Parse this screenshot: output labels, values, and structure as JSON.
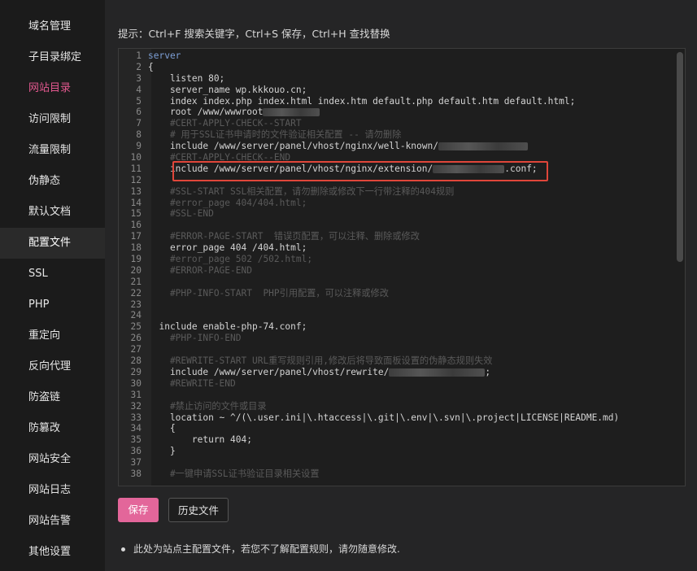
{
  "sidebar": {
    "items": [
      {
        "label": "域名管理"
      },
      {
        "label": "子目录绑定"
      },
      {
        "label": "网站目录"
      },
      {
        "label": "访问限制"
      },
      {
        "label": "流量限制"
      },
      {
        "label": "伪静态"
      },
      {
        "label": "默认文档"
      },
      {
        "label": "配置文件"
      },
      {
        "label": "SSL"
      },
      {
        "label": "PHP"
      },
      {
        "label": "重定向"
      },
      {
        "label": "反向代理"
      },
      {
        "label": "防盗链"
      },
      {
        "label": "防篡改"
      },
      {
        "label": "网站安全"
      },
      {
        "label": "网站日志"
      },
      {
        "label": "网站告警"
      },
      {
        "label": "其他设置"
      }
    ]
  },
  "hint": "提示：Ctrl+F 搜索关键字，Ctrl+S 保存，Ctrl+H 查找替换",
  "editor": {
    "lines": [
      {
        "n": "1",
        "text": "server",
        "style": "kw"
      },
      {
        "n": "2",
        "text": "{",
        "style": "tx"
      },
      {
        "n": "3",
        "text": "    listen 80;",
        "style": "tx"
      },
      {
        "n": "4",
        "text": "    server_name wp.kkkouo.cn;",
        "style": "tx"
      },
      {
        "n": "5",
        "text": "    index index.php index.html index.htm default.php default.htm default.html;",
        "style": "tx"
      },
      {
        "n": "6",
        "text": "    root /www/wwwroot",
        "style": "tx"
      },
      {
        "n": "7",
        "text": "    #CERT-APPLY-CHECK--START",
        "style": "cm"
      },
      {
        "n": "8",
        "text": "    # 用于SSL证书申请时的文件验证相关配置 -- 请勿删除",
        "style": "cm"
      },
      {
        "n": "9",
        "text": "    include /www/server/panel/vhost/nginx/well-known/",
        "style": "tx"
      },
      {
        "n": "10",
        "text": "    #CERT-APPLY-CHECK--END",
        "style": "cm"
      },
      {
        "n": "11",
        "text": "    include /www/server/panel/vhost/nginx/extension/",
        "suffix": ".conf;",
        "style": "tx"
      },
      {
        "n": "12",
        "text": "",
        "style": "tx"
      },
      {
        "n": "13",
        "text": "    #SSL-START SSL相关配置，请勿删除或修改下一行带注释的404规则",
        "style": "cm"
      },
      {
        "n": "14",
        "text": "    #error_page 404/404.html;",
        "style": "cm"
      },
      {
        "n": "15",
        "text": "    #SSL-END",
        "style": "cm"
      },
      {
        "n": "16",
        "text": "",
        "style": "tx"
      },
      {
        "n": "17",
        "text": "    #ERROR-PAGE-START  错误页配置，可以注释、删除或修改",
        "style": "cm"
      },
      {
        "n": "18",
        "text": "    error_page 404 /404.html;",
        "style": "tx"
      },
      {
        "n": "19",
        "text": "    #error_page 502 /502.html;",
        "style": "cm"
      },
      {
        "n": "20",
        "text": "    #ERROR-PAGE-END",
        "style": "cm"
      },
      {
        "n": "21",
        "text": "",
        "style": "tx"
      },
      {
        "n": "22",
        "text": "    #PHP-INFO-START  PHP引用配置，可以注释或修改",
        "style": "cm"
      },
      {
        "n": "23",
        "text": "",
        "style": "tx"
      },
      {
        "n": "24",
        "text": "",
        "style": "tx"
      },
      {
        "n": "25",
        "text": "  include enable-php-74.conf;",
        "style": "tx"
      },
      {
        "n": "26",
        "text": "    #PHP-INFO-END",
        "style": "cm"
      },
      {
        "n": "27",
        "text": "",
        "style": "tx"
      },
      {
        "n": "28",
        "text": "    #REWRITE-START URL重写规则引用,修改后将导致面板设置的伪静态规则失效",
        "style": "cm"
      },
      {
        "n": "29",
        "text": "    include /www/server/panel/vhost/rewrite/",
        "suffix": ";",
        "style": "tx"
      },
      {
        "n": "30",
        "text": "    #REWRITE-END",
        "style": "cm"
      },
      {
        "n": "31",
        "text": "",
        "style": "tx"
      },
      {
        "n": "32",
        "text": "    #禁止访问的文件或目录",
        "style": "cm"
      },
      {
        "n": "33",
        "text": "    location ~ ^/(\\.user.ini|\\.htaccess|\\.git|\\.env|\\.svn|\\.project|LICENSE|README.md)",
        "style": "tx"
      },
      {
        "n": "34",
        "text": "    {",
        "style": "tx"
      },
      {
        "n": "35",
        "text": "        return 404;",
        "style": "tx"
      },
      {
        "n": "36",
        "text": "    }",
        "style": "tx"
      },
      {
        "n": "37",
        "text": "",
        "style": "tx"
      },
      {
        "n": "38",
        "text": "    #一键申请SSL证书验证目录相关设置",
        "style": "cm"
      }
    ]
  },
  "buttons": {
    "save": "保存",
    "history": "历史文件"
  },
  "note": "此处为站点主配置文件，若您不了解配置规则，请勿随意修改.",
  "colors": {
    "accent": "#e3669a",
    "active_nav": "#e3588f",
    "highlight_box": "#e0463a"
  }
}
